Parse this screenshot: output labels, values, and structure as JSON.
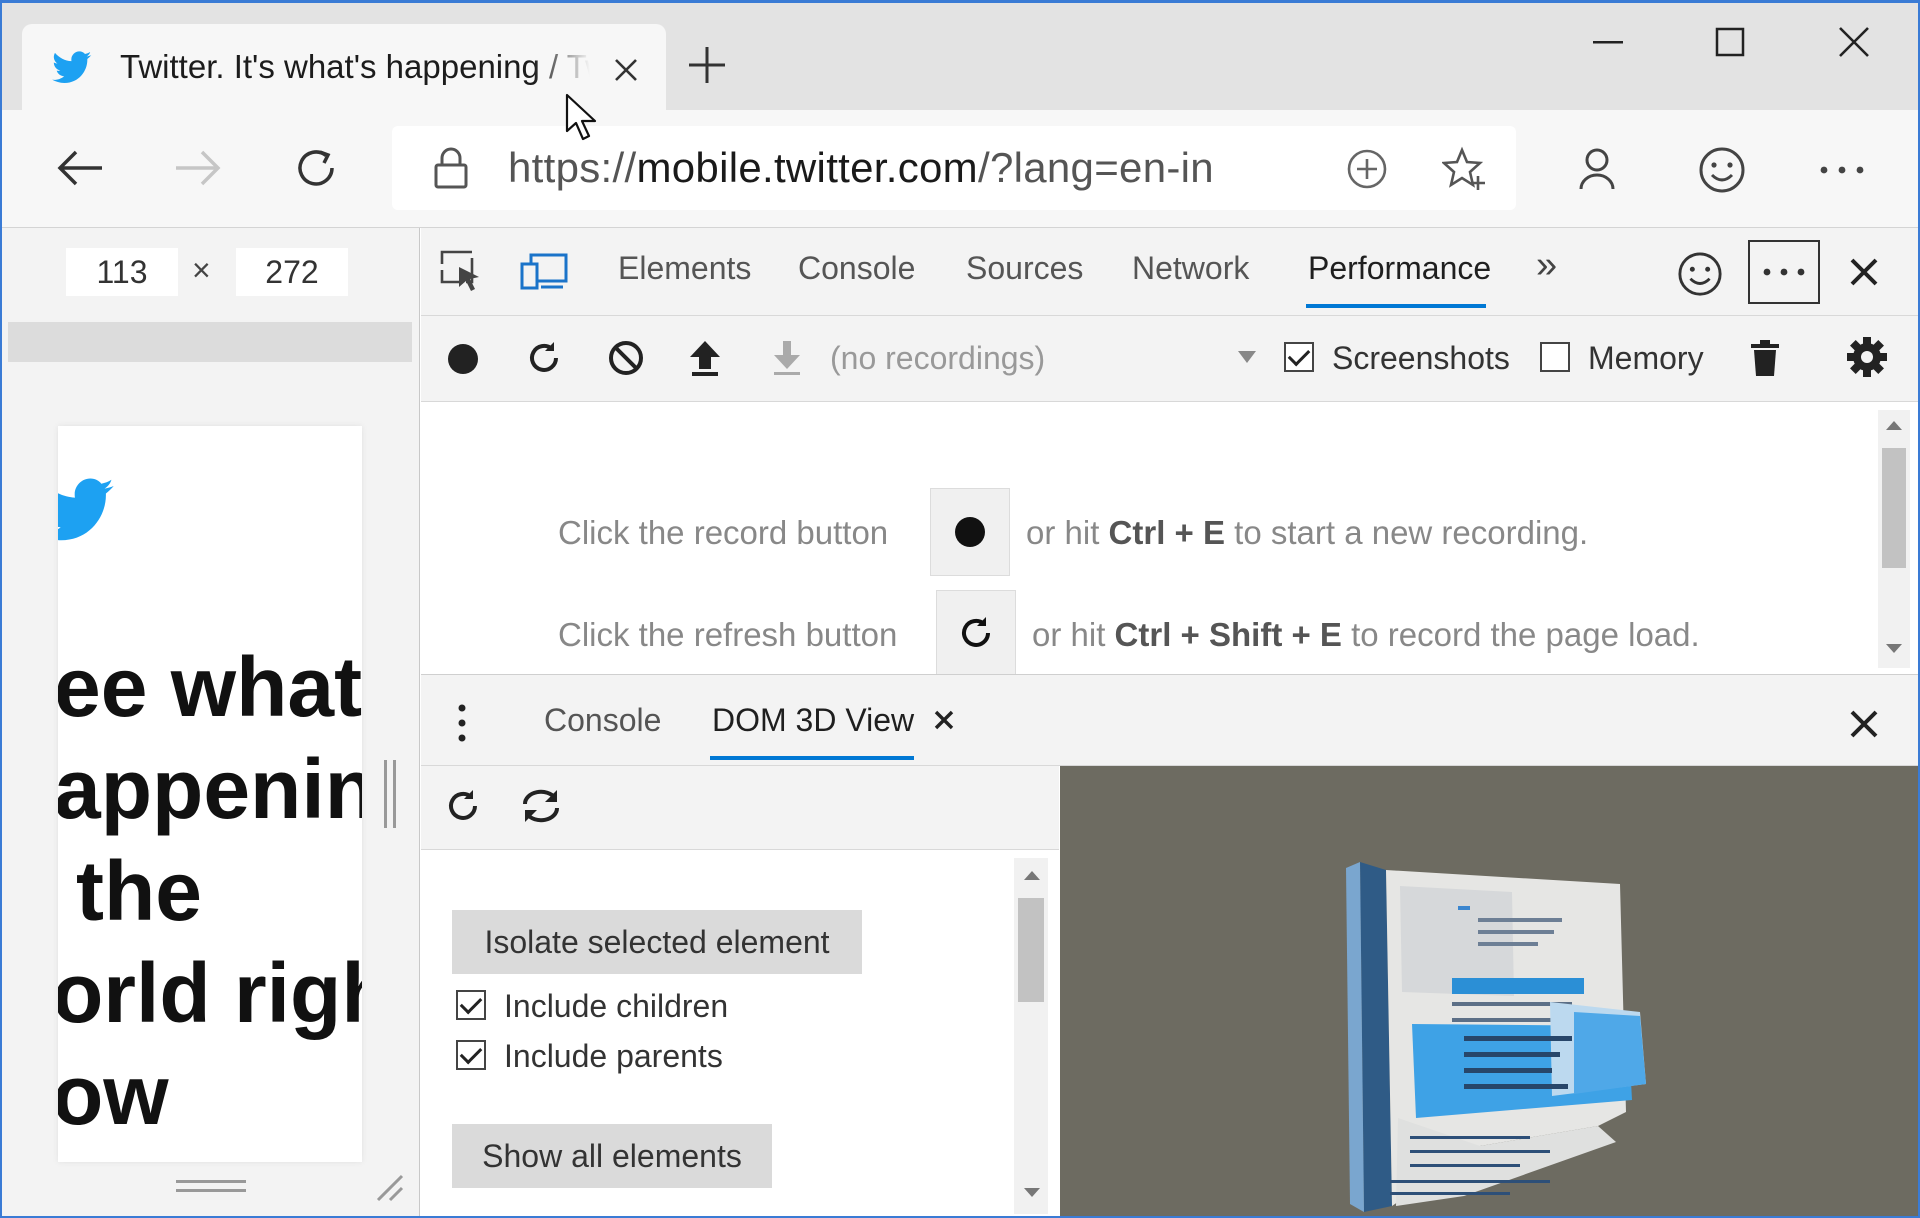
{
  "browser": {
    "tab_title": "Twitter. It's what's happening / Twitter",
    "url_scheme": "https://",
    "url_host": "mobile.twitter.com",
    "url_path": "/?lang=en-in"
  },
  "device_toolbar": {
    "width": "113",
    "times": "×",
    "height": "272"
  },
  "page_preview": {
    "headline": [
      "ee what’s",
      "appening",
      "the",
      "orld righ",
      "ow"
    ]
  },
  "devtools": {
    "tabs": [
      {
        "label": "Elements",
        "active": false
      },
      {
        "label": "Console",
        "active": false
      },
      {
        "label": "Sources",
        "active": false
      },
      {
        "label": "Network",
        "active": false
      },
      {
        "label": "Performance",
        "active": true
      }
    ],
    "more_tabs": "»"
  },
  "performance": {
    "recordings_select": "(no recordings)",
    "screenshots_label": "Screenshots",
    "screenshots_checked": true,
    "memory_label": "Memory",
    "memory_checked": false,
    "hint1_before": "Click the record button",
    "hint1_after_pre": "or hit ",
    "hint1_keys": "Ctrl + E",
    "hint1_after_post": " to start a new recording.",
    "hint2_before": "Click the refresh button",
    "hint2_after_pre": "or hit ",
    "hint2_keys": "Ctrl + Shift + E",
    "hint2_after_post": " to record the page load."
  },
  "drawer": {
    "tabs": [
      {
        "label": "Console",
        "active": false
      },
      {
        "label": "DOM 3D View",
        "active": true
      }
    ]
  },
  "dom3d": {
    "isolate_button": "Isolate selected element",
    "include_children_label": "Include children",
    "include_children_checked": true,
    "include_parents_label": "Include parents",
    "include_parents_checked": true,
    "show_all_button": "Show all elements"
  },
  "colors": {
    "accent": "#0078d4",
    "twitter_blue": "#1da1f2",
    "dom_view_bg": "#6d6b61"
  }
}
